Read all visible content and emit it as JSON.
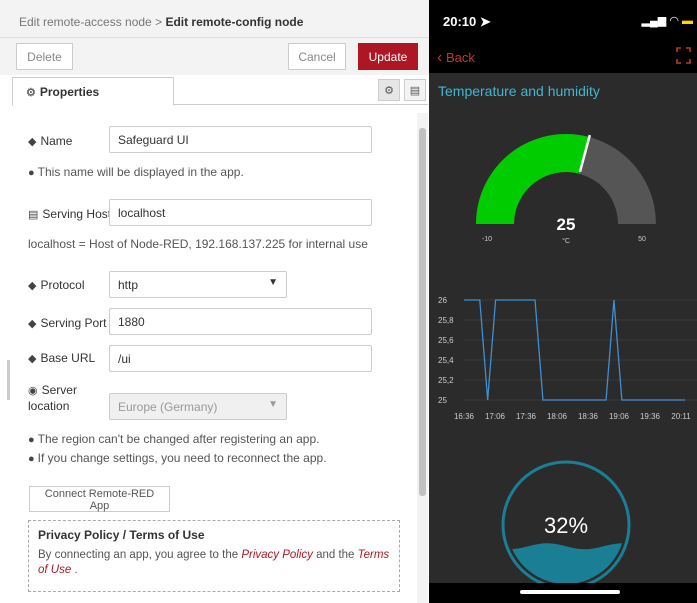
{
  "breadcrumb": {
    "parent": "Edit remote-access node",
    "separator": ">",
    "current": "Edit remote-config node"
  },
  "toolbar": {
    "delete_label": "Delete",
    "cancel_label": "Cancel",
    "update_label": "Update"
  },
  "tabs": {
    "properties_label": "Properties"
  },
  "form": {
    "name": {
      "label": "Name",
      "value": "Safeguard UI"
    },
    "name_info": "This name will be displayed in the app.",
    "host": {
      "label": "Serving Host",
      "value": "localhost"
    },
    "host_info": "localhost = Host of Node-RED, 192.168.137.225 for internal use",
    "protocol": {
      "label": "Protocol",
      "value": "http"
    },
    "port": {
      "label": "Serving Port",
      "value": "1880"
    },
    "base_url": {
      "label": "Base URL",
      "value": "/ui"
    },
    "location": {
      "label_line1": "Server",
      "label_line2": "location",
      "value": "Europe (Germany)"
    },
    "region_info": "The region can't be changed after registering an app.",
    "settings_info": "If you change settings, you need to reconnect the app.",
    "connect_label": "Connect Remote-RED App",
    "privacy": {
      "title": "Privacy Policy / Terms of Use",
      "text_before": "By connecting an app, you agree to the ",
      "privacy_link": "Privacy Policy",
      "text_mid": " and the ",
      "terms_link": "Terms of Use",
      "text_after": " ."
    }
  },
  "phone": {
    "time": "20:10",
    "back_label": "Back",
    "dashboard_title": "Temperature and humidity",
    "gauge": {
      "value": "25",
      "unit": "°C",
      "min": "-10",
      "max": "50",
      "min_value": -10,
      "max_value": 50,
      "current": 25
    },
    "level": {
      "value": "32%",
      "fraction": 0.32
    }
  },
  "chart_data": {
    "type": "line",
    "x": [
      "16:36",
      "16:44",
      "16:52",
      "17:00",
      "17:06",
      "17:12",
      "17:20",
      "17:28",
      "17:36",
      "17:44",
      "17:52",
      "17:58",
      "18:06",
      "18:14",
      "18:22",
      "18:30",
      "18:36",
      "18:44",
      "18:52",
      "19:00",
      "19:06",
      "19:14",
      "19:22",
      "19:30",
      "19:36",
      "19:44",
      "19:52",
      "20:00",
      "20:11"
    ],
    "y": [
      26,
      26,
      26,
      25,
      26,
      26,
      26,
      26,
      26,
      26,
      25,
      25,
      25,
      25,
      25,
      25,
      25,
      25,
      25,
      26,
      25,
      25,
      25,
      25,
      25,
      25,
      25,
      25,
      25
    ],
    "xticks": [
      "16:36",
      "17:06",
      "17:36",
      "18:06",
      "18:36",
      "19:06",
      "19:36",
      "20:11"
    ],
    "yticks": [
      "26",
      "25,8",
      "25,6",
      "25,4",
      "25,2",
      "25"
    ],
    "ylim": [
      25,
      26
    ],
    "title": "",
    "xlabel": "",
    "ylabel": "",
    "color": "#3f8fd2"
  },
  "colors": {
    "accent": "#ad1625",
    "gauge_fill": "#00cc00",
    "gauge_bg": "#555555",
    "title": "#3fb8d2",
    "water": "#1a7f95"
  }
}
